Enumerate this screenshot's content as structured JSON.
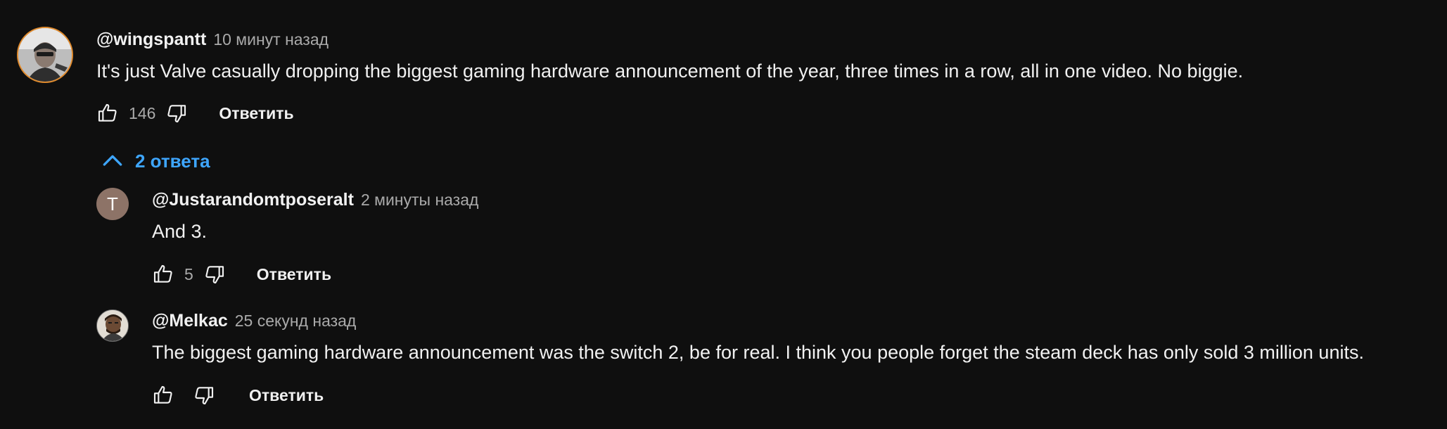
{
  "comment": {
    "author": "@wingspantt",
    "time": "10 минут назад",
    "text": "It's just Valve casually dropping the biggest gaming hardware announcement of the year, three times in a row, all in one video. No biggie.",
    "likes": "146",
    "reply_label": "Ответить"
  },
  "replies_toggle": {
    "label": "2 ответа",
    "color": "#3ea6ff"
  },
  "replies": [
    {
      "avatar_letter": "T",
      "avatar_color": "#8d7367",
      "author": "@Justarandomtposeralt",
      "time": "2 минуты назад",
      "text": "And 3.",
      "likes": "5",
      "reply_label": "Ответить"
    },
    {
      "author": "@Melkac",
      "time": "25 секунд назад",
      "text": "The biggest gaming hardware announcement was the switch 2, be for real. I think you people forget the steam deck has only sold 3 million units.",
      "reply_label": "Ответить"
    }
  ],
  "icons": {
    "like": "thumbs-up-icon",
    "dislike": "thumbs-down-icon",
    "collapse": "chevron-up-icon"
  }
}
